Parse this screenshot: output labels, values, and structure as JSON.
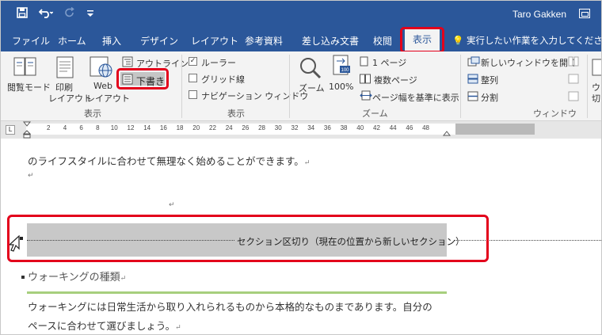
{
  "titlebar": {
    "save_icon": "save-icon",
    "undo_icon": "undo-icon",
    "redo_icon": "redo-icon",
    "customize_icon": "customize-qat-icon",
    "user_name": "Taro Gakken"
  },
  "tabs": [
    {
      "label": "ファイル"
    },
    {
      "label": "ホーム"
    },
    {
      "label": "挿入"
    },
    {
      "label": "デザイン"
    },
    {
      "label": "レイアウト"
    },
    {
      "label": "参考資料"
    },
    {
      "label": "差し込み文書"
    },
    {
      "label": "校閲"
    },
    {
      "label": "表示"
    }
  ],
  "tell_me": "実行したい作業を入力してください",
  "ribbon": {
    "views_group": {
      "read_mode": "閲覧モード",
      "print_layout_1": "印刷",
      "print_layout_2": "レイアウト",
      "web_layout_1": "Web",
      "web_layout_2": "レイアウト",
      "outline": "アウトライン",
      "draft": "下書き",
      "label": "表示"
    },
    "show_group": {
      "ruler": "ルーラー",
      "ruler_checked": "✓",
      "gridlines": "グリッド線",
      "navigation": "ナビゲーション ウィンドウ",
      "label": "表示"
    },
    "zoom_group": {
      "zoom": "ズーム",
      "percent": "100%",
      "one_page": "1 ページ",
      "multiple_pages": "複数ページ",
      "page_width": "ページ幅を基準に表示",
      "label": "ズーム"
    },
    "window_group": {
      "new_window": "新しいウィンドウを開く",
      "arrange": "整列",
      "split": "分割",
      "label": "ウィンドウ",
      "cut1": "ウィ",
      "cut2": "切"
    }
  },
  "ruler": {
    "corner": "L",
    "ticks": [
      "2",
      "4",
      "6",
      "8",
      "10",
      "12",
      "14",
      "16",
      "18",
      "20",
      "22",
      "24",
      "26",
      "28",
      "30",
      "32",
      "34",
      "36",
      "38",
      "40",
      "42",
      "44",
      "46",
      "48"
    ]
  },
  "document": {
    "line1": "のライフスタイルに合わせて無理なく始めることができます。",
    "para_mark": "↵",
    "section_break": "セクション区切り（現在の位置から新しいセクション）",
    "heading": "ウォーキングの種類",
    "body1": "ウォーキングには日常生活から取り入れられるものから本格的なものまであります。自分の",
    "body2": "ペースに合わせて選びましょう。"
  },
  "colors": {
    "accent": "#2b579a",
    "highlight": "#e3001b",
    "ribbon_bg": "#f3f3f3",
    "heading_rule": "#a7cf7d"
  }
}
